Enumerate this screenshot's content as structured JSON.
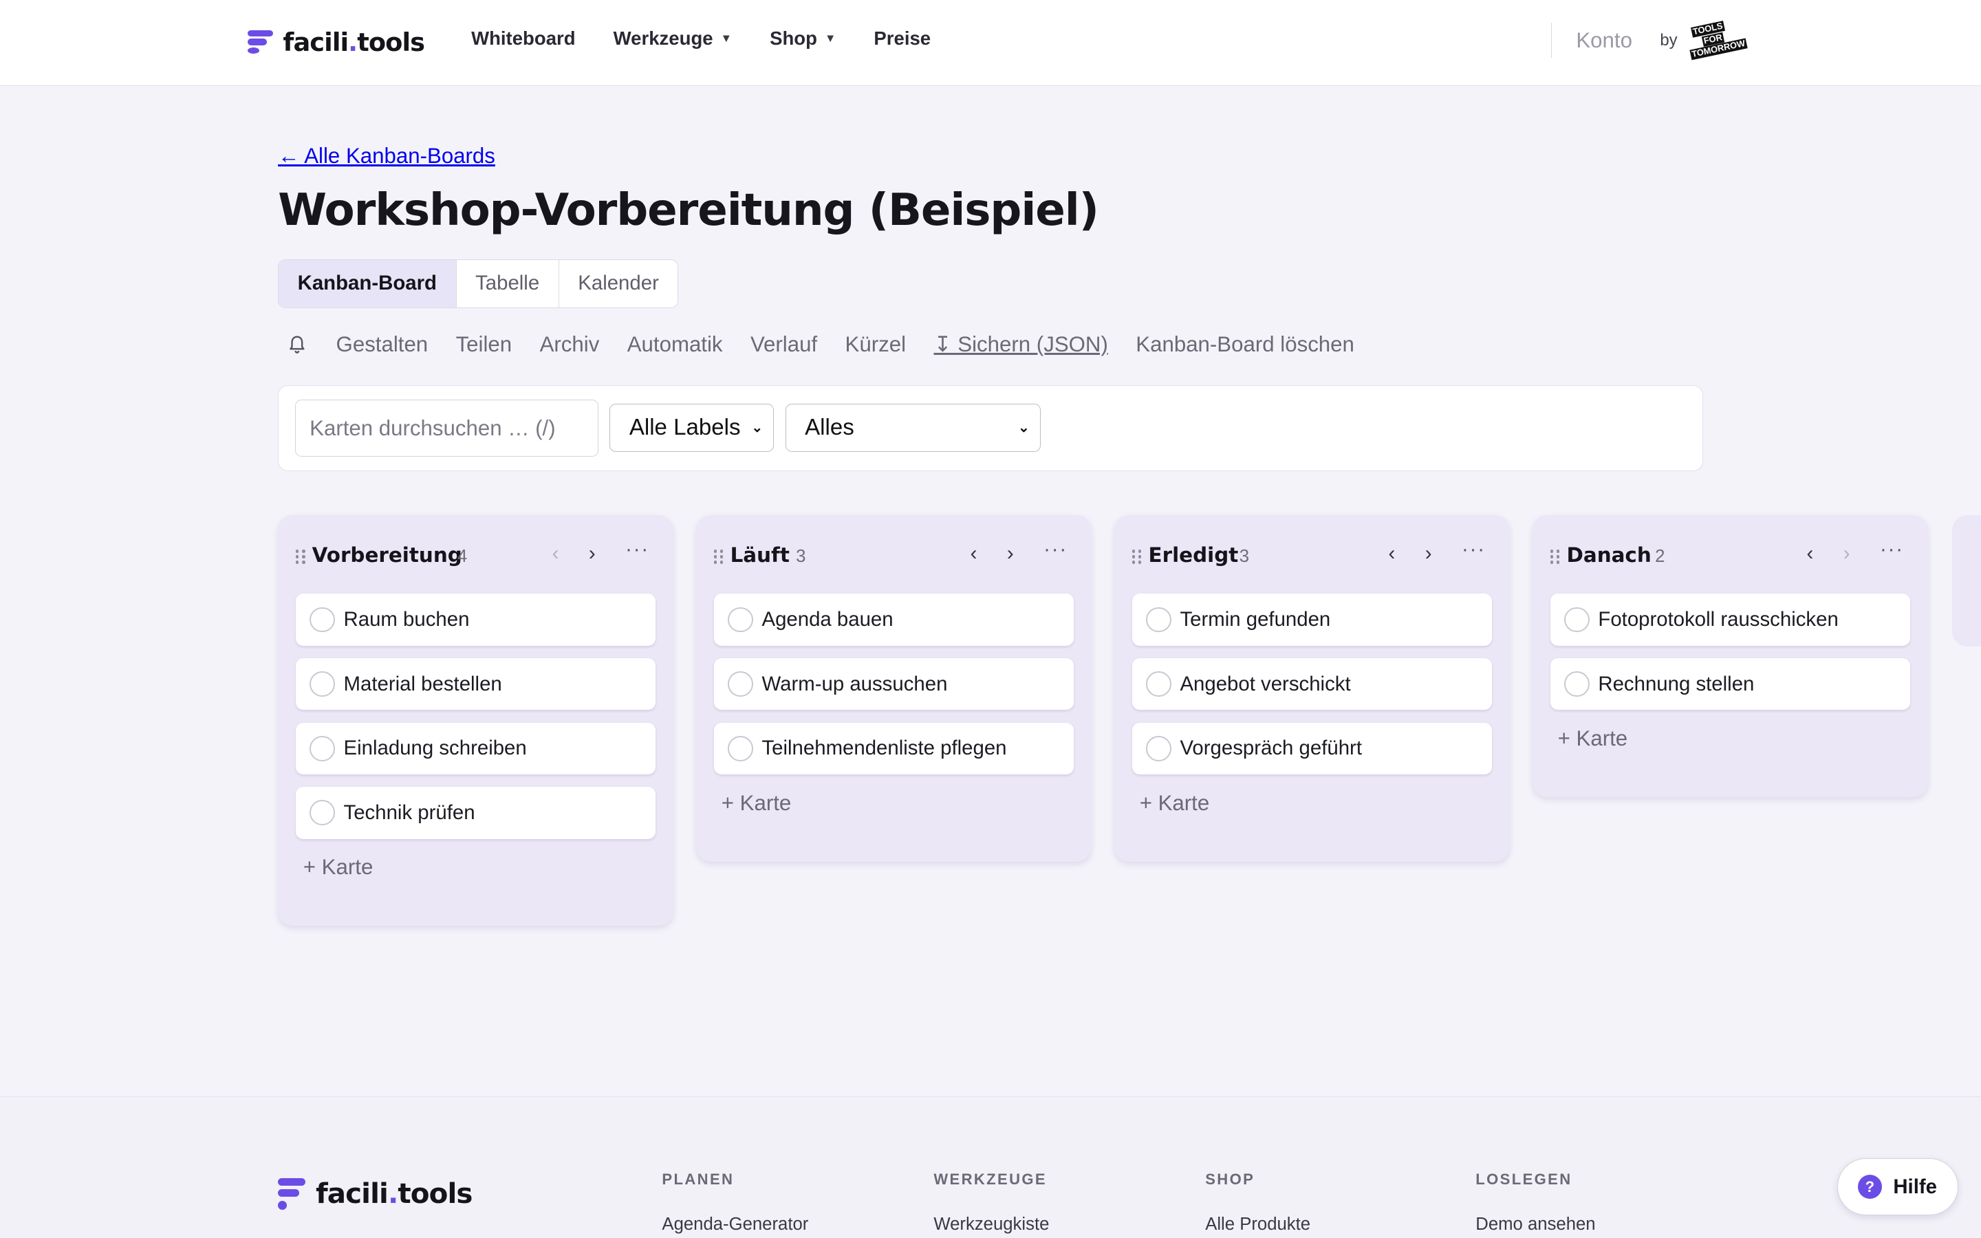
{
  "brand": {
    "name_prefix": "facili",
    "name_dot": ".",
    "name_suffix": "tools"
  },
  "nav": {
    "items": [
      {
        "label": "Whiteboard",
        "has_dropdown": false
      },
      {
        "label": "Werkzeuge",
        "has_dropdown": true
      },
      {
        "label": "Shop",
        "has_dropdown": true
      },
      {
        "label": "Preise",
        "has_dropdown": false
      }
    ],
    "caret": "▼",
    "account": "Konto",
    "by": "by",
    "partner_logo_lines": [
      "TOOLS",
      "FOR",
      "TOMORROW"
    ]
  },
  "page": {
    "back_link": "← Alle Kanban-Boards",
    "title": "Workshop-Vorbereitung (Beispiel)",
    "view_tabs": [
      {
        "label": "Kanban-Board",
        "active": true
      },
      {
        "label": "Tabelle",
        "active": false
      },
      {
        "label": "Kalender",
        "active": false
      }
    ],
    "toolbar": {
      "bell_icon": "bell-icon",
      "actions": [
        {
          "label": "Gestalten",
          "underlined": false
        },
        {
          "label": "Teilen",
          "underlined": false
        },
        {
          "label": "Archiv",
          "underlined": false
        },
        {
          "label": "Automatik",
          "underlined": false
        },
        {
          "label": "Verlauf",
          "underlined": false
        },
        {
          "label": "Kürzel",
          "underlined": false
        },
        {
          "label": "↧ Sichern (JSON)",
          "underlined": true
        },
        {
          "label": "Kanban-Board löschen",
          "underlined": false
        }
      ]
    },
    "filters": {
      "search_placeholder": "Karten durchsuchen … (/)",
      "label_filter": "Alle Labels",
      "status_filter": "Alles"
    }
  },
  "board": {
    "add_card_label": "+ Karte",
    "columns": [
      {
        "name": "Vorbereitung",
        "count": "4",
        "prev_disabled": true,
        "cards": [
          "Raum buchen",
          "Material bestellen",
          "Einladung schreiben",
          "Technik prüfen"
        ]
      },
      {
        "name": "Läuft",
        "count": "3",
        "prev_disabled": false,
        "cards": [
          "Agenda bauen",
          "Warm-up aussuchen",
          "Teilnehmendenliste pflegen"
        ]
      },
      {
        "name": "Erledigt",
        "count": "3",
        "prev_disabled": false,
        "cards": [
          "Termin gefunden",
          "Angebot verschickt",
          "Vorgespräch geführt"
        ]
      },
      {
        "name": "Danach",
        "count": "2",
        "prev_disabled": false,
        "next_disabled": true,
        "cards": [
          "Fotoprotokoll rausschicken",
          "Rechnung stellen"
        ]
      }
    ]
  },
  "footer": {
    "columns": [
      {
        "heading": "PLANEN",
        "first_link": "Agenda-Generator"
      },
      {
        "heading": "WERKZEUGE",
        "first_link": "Werkzeugkiste"
      },
      {
        "heading": "SHOP",
        "first_link": "Alle Produkte"
      },
      {
        "heading": "LOSLEGEN",
        "first_link": "Demo ansehen"
      }
    ]
  },
  "help": {
    "label": "Hilfe",
    "icon": "?"
  },
  "colors": {
    "accent": "#6b4de6",
    "background": "#f4f3fa",
    "column_bg": "#ebe7f6",
    "active_tab": "#e8e4f7"
  }
}
